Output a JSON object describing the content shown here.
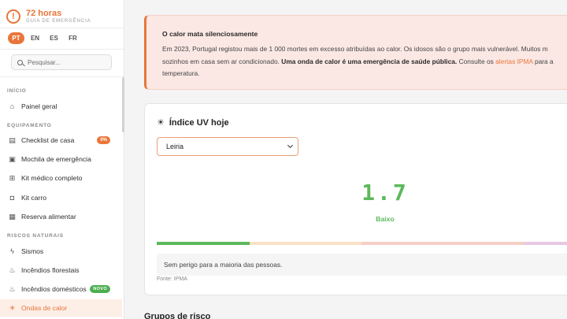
{
  "brand": {
    "title": "72 horas",
    "subtitle": "GUIA DE EMERGÊNCIA",
    "icon": "alert-circle-icon"
  },
  "languages": [
    {
      "code": "PT",
      "active": true
    },
    {
      "code": "EN",
      "active": false
    },
    {
      "code": "ES",
      "active": false
    },
    {
      "code": "FR",
      "active": false
    }
  ],
  "search": {
    "placeholder": "Pesquisar..."
  },
  "sidebar": {
    "sections": [
      {
        "label": "INÍCIO"
      },
      {
        "label": "EQUIPAMENTO"
      },
      {
        "label": "RISCOS NATURAIS"
      }
    ],
    "items": [
      {
        "label": "Painel geral",
        "icon": "home-icon"
      },
      {
        "label": "Checklist de casa",
        "icon": "box-icon",
        "badge": "0%"
      },
      {
        "label": "Mochila de emergência",
        "icon": "backpack-icon"
      },
      {
        "label": "Kit médico completo",
        "icon": "medical-kit-icon"
      },
      {
        "label": "Kit carro",
        "icon": "car-icon"
      },
      {
        "label": "Reserva alimentar",
        "icon": "storage-icon"
      },
      {
        "label": "Sismos",
        "icon": "lightning-icon"
      },
      {
        "label": "Incêndios florestais",
        "icon": "flame-icon"
      },
      {
        "label": "Incêndios domésticos",
        "icon": "flame-icon",
        "badge": "NOVO"
      },
      {
        "label": "Ondas de calor",
        "icon": "sun-icon",
        "active": true
      }
    ]
  },
  "alert": {
    "title": "O calor mata silenciosamente",
    "body_1": "Em 2023, Portugal registou mais de 1 000 mortes em excesso atribuídas ao calor. Os idosos são o grupo mais vulnerável. Muitos m",
    "body_2": "sozinhos em casa sem ar condicionado. ",
    "body_bold": "Uma onda de calor é uma emergência de saúde pública.",
    "body_3": " Consulte os ",
    "link": "alertas IPMA",
    "body_4": " para a",
    "body_5": "temperatura."
  },
  "uv": {
    "title": "Índice UV hoje",
    "selected_location": "Leiria",
    "value": "1.7",
    "level": "Baixo",
    "note": "Sem perigo para a maioria das pessoas.",
    "source": "Fonte: IPMA",
    "scale_colors": [
      "#5cb85c",
      "#fbe0c6",
      "#f6cfc4",
      "#e7c9e4"
    ]
  },
  "next_section": {
    "title": "Grupos de risco"
  },
  "colors": {
    "accent": "#e8763a",
    "low_uv": "#5cb85c",
    "badge_new": "#4caf50"
  }
}
